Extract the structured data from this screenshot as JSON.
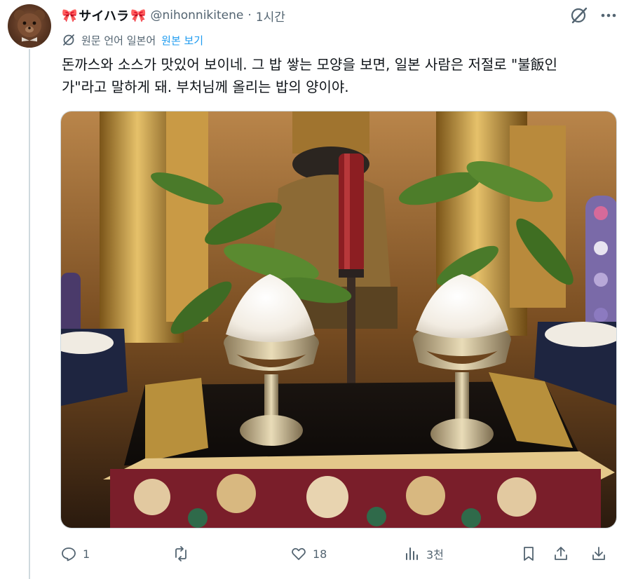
{
  "post": {
    "display_name": "サイハラ",
    "ribbon_left": "🎀",
    "ribbon_right": "🎀",
    "handle": "@nihonnikitene",
    "separator": "·",
    "time": "1시간",
    "translation": {
      "label": "원문 언어 일본어",
      "link": "원본 보기"
    },
    "text_lines": [
      "돈까스와 소스가 맛있어 보이네. 그 밥 쌓는 모양을 보면, 일본 사람은 저절로 \"불飯인",
      "가\"라고 말하게 돼. 부처님께 올리는 밥의 양이야."
    ]
  },
  "actions": {
    "reply_count": "1",
    "repost_count": "",
    "like_count": "18",
    "views_count": "3천"
  },
  "icons": {
    "grok": "grok-icon",
    "more": "more-icon",
    "translate": "translate-icon",
    "reply": "reply-icon",
    "repost": "repost-icon",
    "like": "heart-icon",
    "views": "views-icon",
    "bookmark": "bookmark-icon",
    "share": "share-icon",
    "download": "download-icon"
  },
  "colors": {
    "text": "#0f1419",
    "muted": "#536471",
    "link": "#1d9bf0",
    "border": "#cfd9de"
  }
}
